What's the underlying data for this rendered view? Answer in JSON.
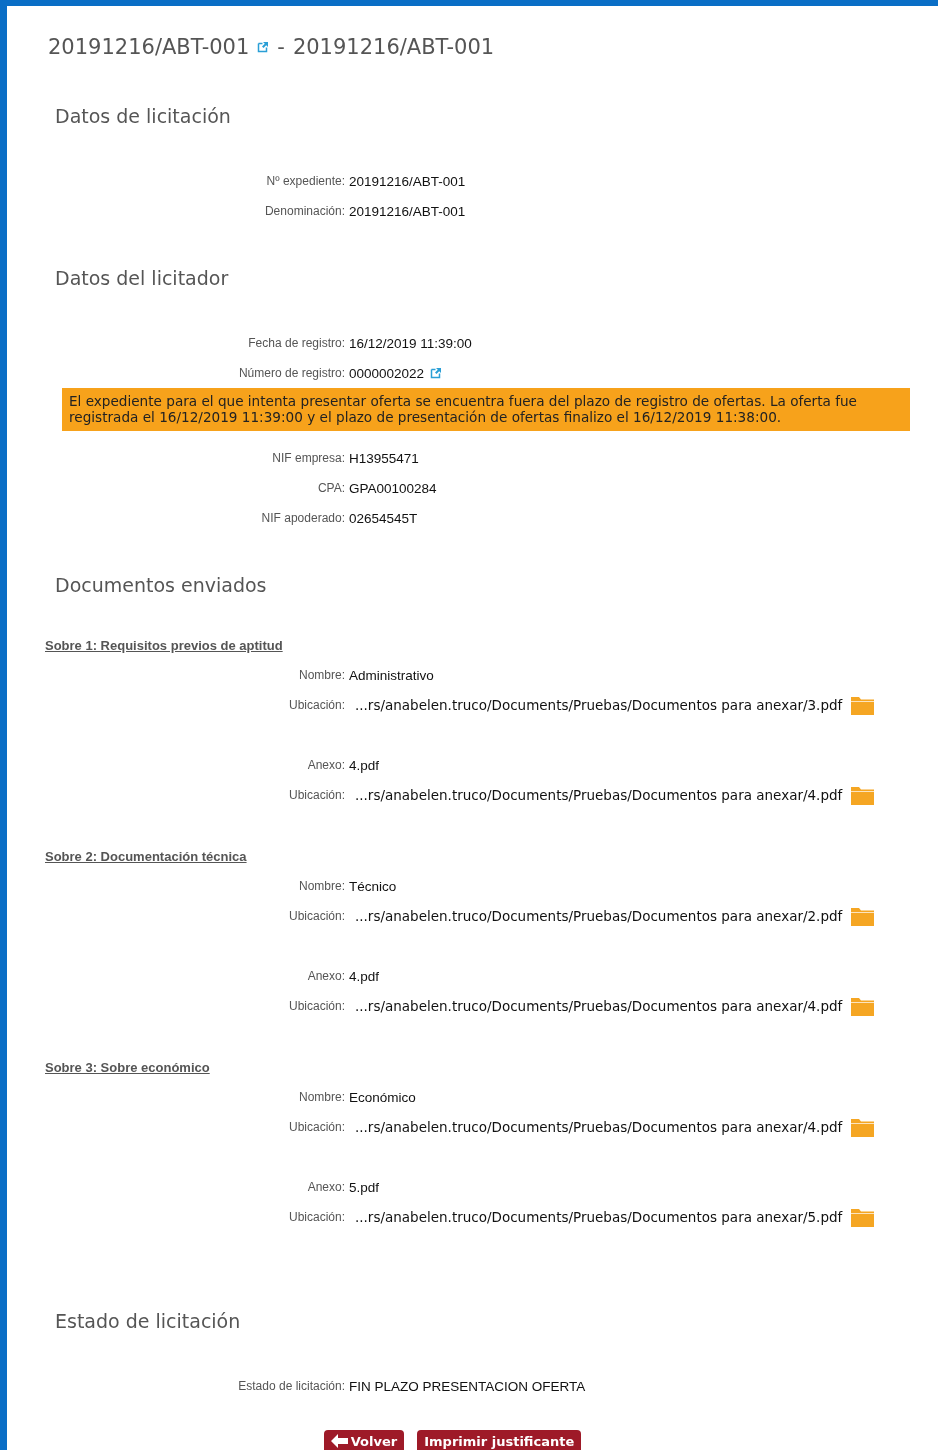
{
  "title": {
    "code": "20191216/ABT-001",
    "separator": "-",
    "name": "20191216/ABT-001"
  },
  "datos_licitacion": {
    "heading": "Datos de licitación",
    "items": [
      {
        "kind": "field",
        "label": "Nº expediente:",
        "value": "20191216/ABT-001"
      },
      {
        "kind": "field",
        "label": "Denominación:",
        "value": "20191216/ABT-001"
      }
    ]
  },
  "datos_licitador": {
    "heading": "Datos del licitador",
    "items": [
      {
        "kind": "field",
        "label": "Fecha de registro:",
        "value": "16/12/2019 11:39:00"
      },
      {
        "kind": "link",
        "label": "Número de registro:",
        "value": "0000002022"
      },
      {
        "kind": "alert",
        "text": "El expediente para el que intenta presentar oferta se encuentra fuera del plazo de registro de ofertas. La oferta fue registrada el 16/12/2019 11:39:00 y el plazo de presentación de ofertas finalizo el 16/12/2019 11:38:00."
      },
      {
        "kind": "field",
        "label": "NIF empresa:",
        "value": "H13955471"
      },
      {
        "kind": "field",
        "label": "CPA:",
        "value": "GPA00100284"
      },
      {
        "kind": "field",
        "label": "NIF apoderado:",
        "value": "02654545T"
      }
    ]
  },
  "documentos": {
    "heading": "Documentos enviados",
    "sobres": [
      {
        "title": "Sobre 1: Requisitos previos de aptitud",
        "documents": [
          {
            "label": "Nombre:",
            "value": "Administrativo",
            "location_label": "Ubicación:",
            "location": "...rs/anabelen.truco/Documents/Pruebas/Documentos para anexar/3.pdf"
          },
          {
            "label": "Anexo:",
            "value": "4.pdf",
            "location_label": "Ubicación:",
            "location": "...rs/anabelen.truco/Documents/Pruebas/Documentos para anexar/4.pdf"
          }
        ]
      },
      {
        "title": "Sobre 2: Documentación técnica",
        "documents": [
          {
            "label": "Nombre:",
            "value": "Técnico",
            "location_label": "Ubicación:",
            "location": "...rs/anabelen.truco/Documents/Pruebas/Documentos para anexar/2.pdf"
          },
          {
            "label": "Anexo:",
            "value": "4.pdf",
            "location_label": "Ubicación:",
            "location": "...rs/anabelen.truco/Documents/Pruebas/Documentos para anexar/4.pdf"
          }
        ]
      },
      {
        "title": "Sobre 3: Sobre económico",
        "documents": [
          {
            "label": "Nombre:",
            "value": "Económico",
            "location_label": "Ubicación:",
            "location": "...rs/anabelen.truco/Documents/Pruebas/Documentos para anexar/4.pdf"
          },
          {
            "label": "Anexo:",
            "value": "5.pdf",
            "location_label": "Ubicación:",
            "location": "...rs/anabelen.truco/Documents/Pruebas/Documentos para anexar/5.pdf"
          }
        ]
      }
    ]
  },
  "estado": {
    "heading": "Estado de licitación",
    "items": [
      {
        "kind": "field",
        "label": "Estado de licitación:",
        "value": "FIN PLAZO PRESENTACION OFERTA"
      }
    ]
  },
  "buttons": [
    {
      "kind": "back",
      "label": "Volver"
    },
    {
      "kind": "print",
      "label": "Imprimir justificante"
    }
  ]
}
